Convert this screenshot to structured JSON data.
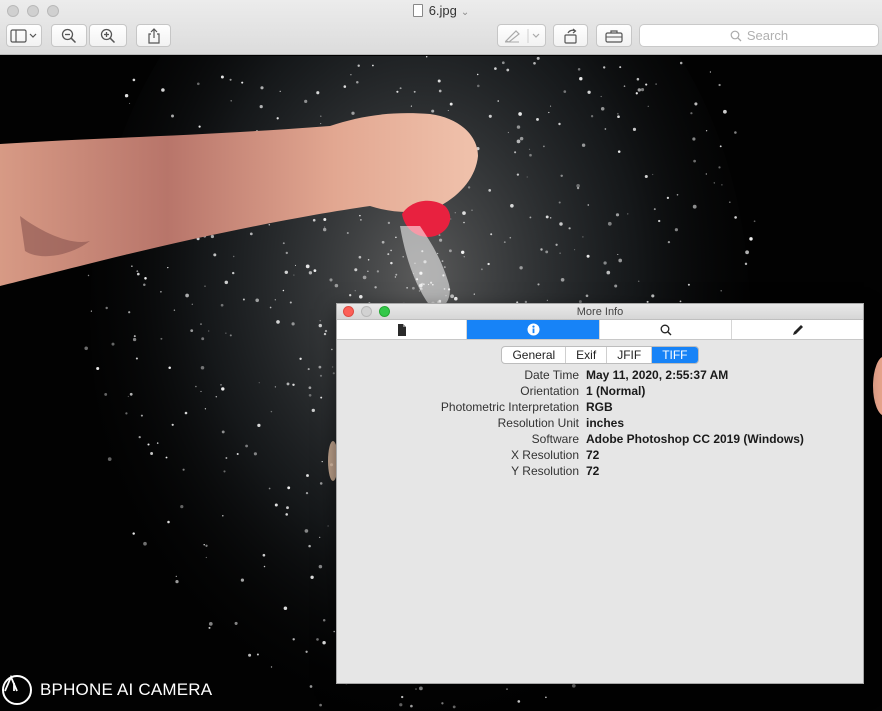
{
  "window": {
    "title": "6.jpg"
  },
  "toolbar": {
    "sidebar_button": "sidebar-toggle",
    "zoom_out": "zoom-out",
    "zoom_in": "zoom-in",
    "share": "share",
    "markup": "markup",
    "rotate": "rotate",
    "toolbox": "toolbox",
    "search_placeholder": "Search"
  },
  "image": {
    "watermark": "BPHONE AI CAMERA"
  },
  "more_info": {
    "title": "More Info",
    "tabs": [
      {
        "icon": "document-icon",
        "active": false
      },
      {
        "icon": "info-icon",
        "active": true
      },
      {
        "icon": "search-icon",
        "active": false
      },
      {
        "icon": "pencil-icon",
        "active": false
      }
    ],
    "segments": [
      "General",
      "Exif",
      "JFIF",
      "TIFF"
    ],
    "active_segment": "TIFF",
    "rows": [
      {
        "key": "Date Time",
        "value": "May 11, 2020, 2:55:37 AM"
      },
      {
        "key": "Orientation",
        "value": "1 (Normal)"
      },
      {
        "key": "Photometric Interpretation",
        "value": "RGB"
      },
      {
        "key": "Resolution Unit",
        "value": "inches"
      },
      {
        "key": "Software",
        "value": "Adobe Photoshop CC 2019 (Windows)"
      },
      {
        "key": "X Resolution",
        "value": "72"
      },
      {
        "key": "Y Resolution",
        "value": "72"
      }
    ]
  }
}
